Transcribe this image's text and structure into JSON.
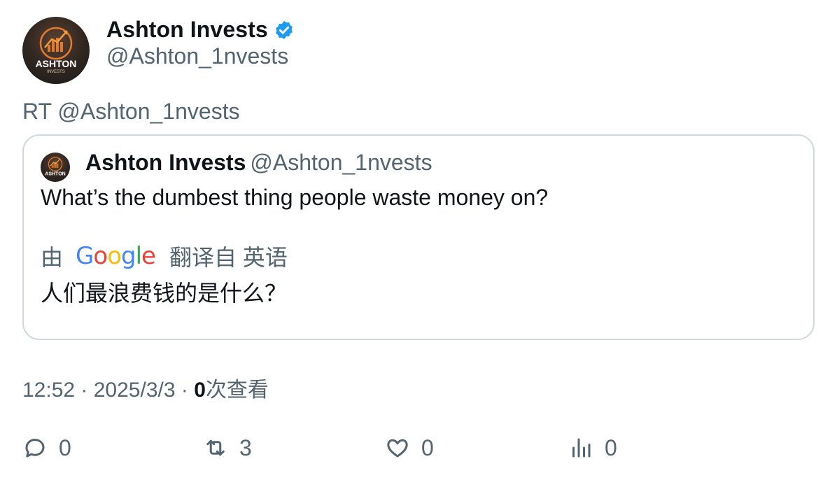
{
  "author": {
    "display_name": "Ashton Invests",
    "handle": "@Ashton_1nvests",
    "verified_icon": "verified-badge-icon",
    "avatar_text": "ASHTON",
    "avatar_subtext": "INVESTS"
  },
  "retweet_line": "RT @Ashton_1nvests",
  "quoted_tweet": {
    "display_name": "Ashton Invests",
    "handle": "@Ashton_1nvests",
    "text": "What’s the dumbest thing people waste money on?",
    "translation": {
      "by_label": "由",
      "provider": "Google",
      "source_label": "翻译自 英语",
      "text": "人们最浪费钱的是什么？"
    }
  },
  "meta": {
    "time": "12:52",
    "separator": " · ",
    "date": "2025/3/3",
    "views_count": "0",
    "views_label": "次查看"
  },
  "actions": {
    "reply_count": "0",
    "retweet_count": "3",
    "like_count": "0",
    "views_count": "0"
  },
  "colors": {
    "verified": "#1d9bf0",
    "secondary_text": "#536471",
    "primary_text": "#0f1419",
    "border": "#cfd9de"
  }
}
